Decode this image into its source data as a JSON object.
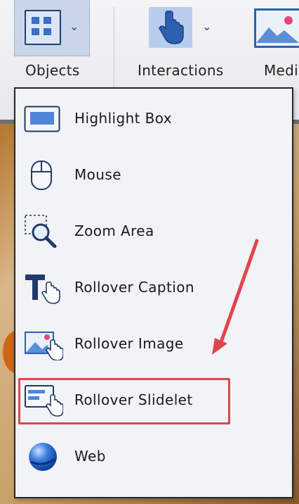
{
  "ribbon": {
    "objects_label": "Objects",
    "interactions_label": "Interactions",
    "media_label": "Medi"
  },
  "menu": {
    "items": [
      {
        "label": "Highlight Box",
        "icon": "highlight-box-icon"
      },
      {
        "label": "Mouse",
        "icon": "mouse-icon"
      },
      {
        "label": "Zoom Area",
        "icon": "zoom-area-icon"
      },
      {
        "label": "Rollover Caption",
        "icon": "rollover-caption-icon"
      },
      {
        "label": "Rollover Image",
        "icon": "rollover-image-icon"
      },
      {
        "label": "Rollover Slidelet",
        "icon": "rollover-slidelet-icon"
      },
      {
        "label": "Web",
        "icon": "web-icon"
      }
    ]
  },
  "colors": {
    "accent_blue": "#3b6fc8",
    "annotation_red": "#e0454c",
    "menu_bg": "#f2f3f6"
  }
}
